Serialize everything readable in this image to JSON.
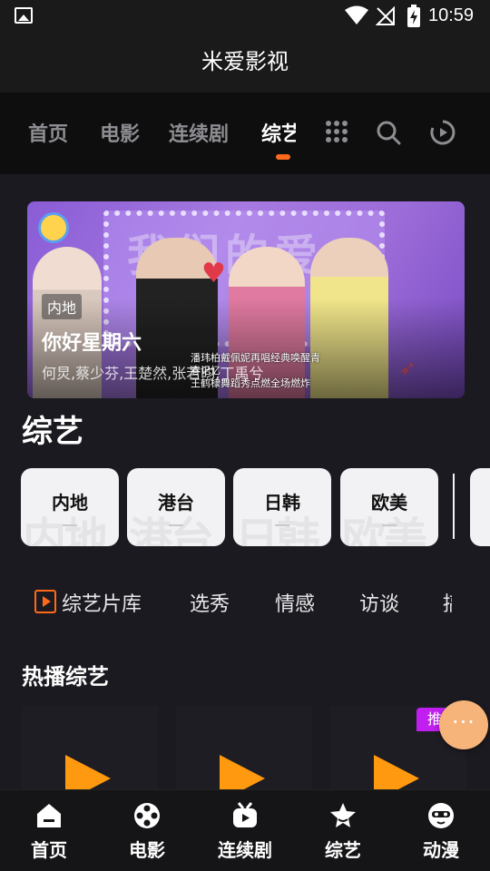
{
  "status_bar": {
    "time": "10:59",
    "icons": [
      "image-icon",
      "wifi-icon",
      "no-signal-icon",
      "battery-charging-icon"
    ]
  },
  "app": {
    "title": "米爱影视"
  },
  "top_tabs": {
    "items": [
      {
        "label": "首页",
        "active": false
      },
      {
        "label": "电影",
        "active": false
      },
      {
        "label": "连续剧",
        "active": false
      },
      {
        "label": "综艺",
        "active": true
      }
    ],
    "icons": [
      "grid-icon",
      "search-icon",
      "history-play-icon"
    ],
    "accent": "#ff6a1a"
  },
  "banner": {
    "tag": "内地",
    "title": "你好星期六",
    "subtitle": "何炅,蔡少芬,王楚然,张若昀,丁禹兮",
    "caption_line1": "潘玮柏戴佩妮再唱经典唤醒青春记忆",
    "caption_line2": "王鹤棣舞蹈秀点燃全场燃炸"
  },
  "section": {
    "title": "综艺"
  },
  "regions": [
    {
      "label": "内地",
      "watermark": "内地"
    },
    {
      "label": "港台",
      "watermark": "港台"
    },
    {
      "label": "日韩",
      "watermark": "日韩"
    },
    {
      "label": "欧美",
      "watermark": "欧美"
    }
  ],
  "categories": {
    "library_label": "综艺片库",
    "items": [
      "选秀",
      "情感",
      "访谈"
    ],
    "clipped": "搞"
  },
  "hot": {
    "title": "热播综艺",
    "badge": "推荐"
  },
  "fab": {
    "label": "···"
  },
  "bottom_nav": [
    {
      "label": "首页",
      "icon": "home-icon"
    },
    {
      "label": "电影",
      "icon": "film-reel-icon"
    },
    {
      "label": "连续剧",
      "icon": "tv-icon"
    },
    {
      "label": "综艺",
      "icon": "star-icon"
    },
    {
      "label": "动漫",
      "icon": "anime-face-icon"
    }
  ]
}
